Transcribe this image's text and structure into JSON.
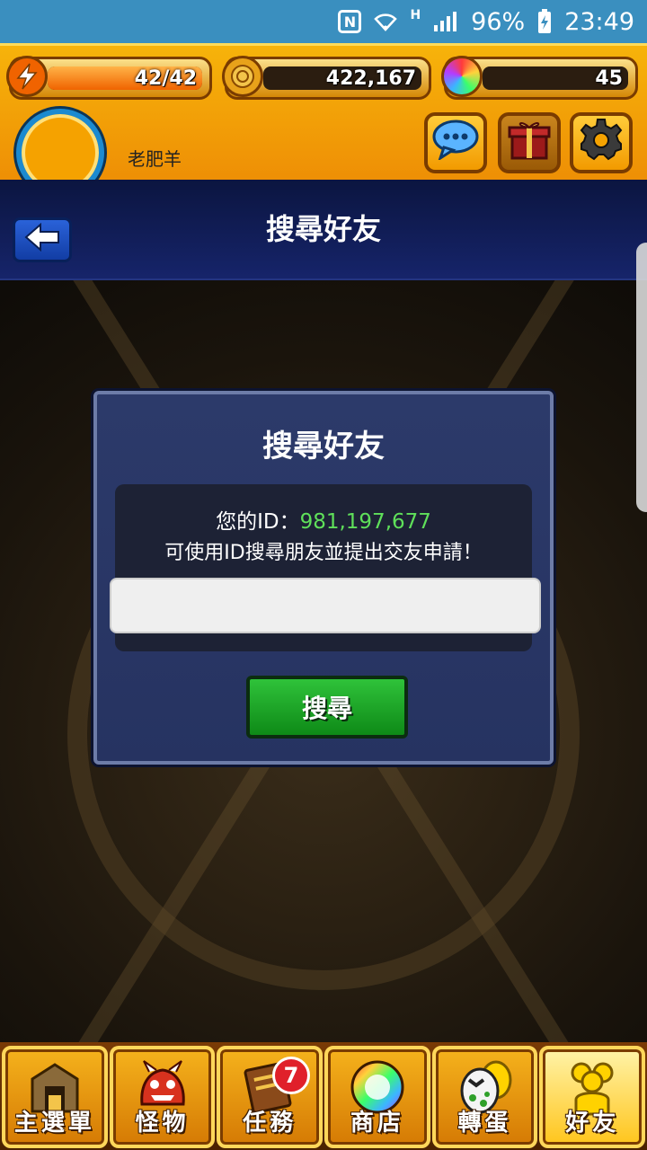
{
  "status_bar": {
    "battery": "96%",
    "time": "23:49",
    "network": "H"
  },
  "hud": {
    "stamina": "42/42",
    "stamina_fraction": 1.0,
    "gold": "422,167",
    "gems": "45",
    "player_name": "老肥羊",
    "icons": {
      "stamina": "lightning-icon",
      "gold": "coin-icon",
      "gems": "rainbow-orb-icon",
      "chat": "chat-bubble-icon",
      "gift": "gift-box-icon",
      "settings": "gear-icon"
    }
  },
  "header": {
    "title": "搜尋好友",
    "back_icon": "back-arrow-icon"
  },
  "dialog": {
    "title": "搜尋好友",
    "id_label": "您的ID：",
    "id_value": "981,197,677",
    "hint": "可使用ID搜尋朋友並提出交友申請！",
    "input_value": "",
    "input_placeholder": "",
    "search_button": "搜尋"
  },
  "bottom_nav": {
    "items": [
      {
        "label": "主選單",
        "icon": "home-gate-icon"
      },
      {
        "label": "怪物",
        "icon": "monster-icon"
      },
      {
        "label": "任務",
        "icon": "quest-book-icon",
        "badge": "7"
      },
      {
        "label": "商店",
        "icon": "rainbow-orb-icon"
      },
      {
        "label": "轉蛋",
        "icon": "egg-icon"
      },
      {
        "label": "好友",
        "icon": "friends-icon",
        "active": true
      }
    ]
  },
  "colors": {
    "status_bar": "#3a8fbf",
    "hud": "#f5a70a",
    "title_banner": "#0b1540",
    "dialog": "#2c3a6a",
    "id_value": "#5fe05a",
    "search_button": "#1fa82a"
  }
}
